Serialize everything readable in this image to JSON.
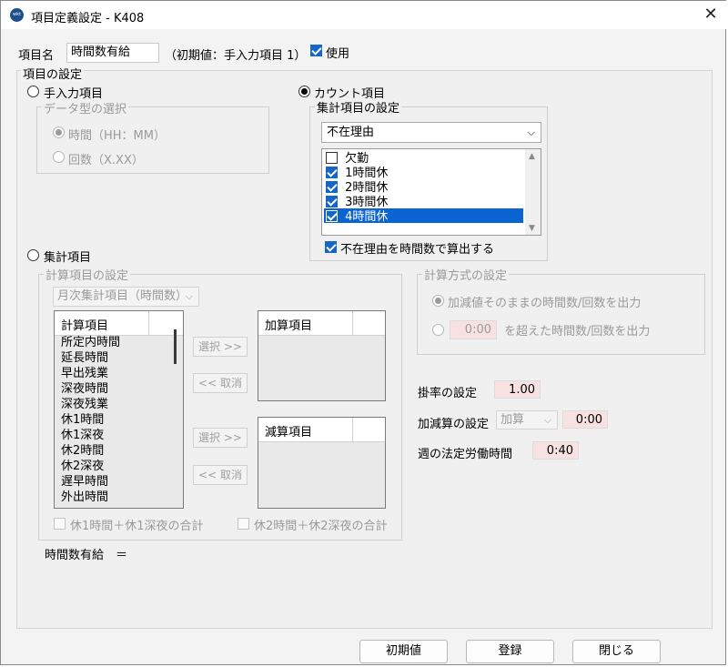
{
  "window": {
    "title": "項目定義設定 - K408",
    "app_icon_text": "wkt"
  },
  "item_name": {
    "label": "項目名",
    "value": "時間数有給",
    "initial": "（初期値：手入力項目 1）",
    "use_label": "使用",
    "use_checked": true
  },
  "settings": {
    "legend": "項目の設定",
    "manual": {
      "label": "手入力項目",
      "selected": false,
      "data_type_legend": "データ型の選択",
      "options": [
        {
          "label": "時間（HH：MM）",
          "selected": true
        },
        {
          "label": "回数（X.XX）",
          "selected": false
        }
      ]
    },
    "count": {
      "label": "カウント項目",
      "selected": true,
      "agg_legend": "集計項目の設定",
      "combo_value": "不在理由",
      "list": [
        {
          "label": "欠勤",
          "checked": false,
          "selected": false
        },
        {
          "label": "1時間休",
          "checked": true,
          "selected": false
        },
        {
          "label": "2時間休",
          "checked": true,
          "selected": false
        },
        {
          "label": "3時間休",
          "checked": true,
          "selected": false
        },
        {
          "label": "4時間休",
          "checked": true,
          "selected": true
        }
      ],
      "absence_hours_label": "不在理由を時間数で算出する",
      "absence_hours_checked": true
    },
    "aggregate": {
      "label": "集計項目",
      "selected": false,
      "calc_legend": "計算項目の設定",
      "monthly_combo": "月次集計項目（時間数）",
      "calc_items_header": "計算項目",
      "calc_items": [
        "所定内時間",
        "延長時間",
        "早出残業",
        "深夜時間",
        "深夜残業",
        "休1時間",
        "休1深夜",
        "休2時間",
        "休2深夜",
        "遅早時間",
        "外出時間"
      ],
      "add_header": "加算項目",
      "sub_header": "減算項目",
      "select_btn": "選択 >>",
      "cancel_btn": "<< 取消",
      "sum1_label": "休1時間＋休1深夜の合計",
      "sum2_label": "休2時間＋休2深夜の合計",
      "method_legend": "計算方式の設定",
      "method_opt1": "加減値そのままの時間数/回数を出力",
      "method_opt2_value": "0:00",
      "method_opt2_suffix": "を超えた時間数/回数を出力"
    },
    "rate_label": "掛率の設定",
    "rate_value": "1.00",
    "addsub_label": "加減算の設定",
    "addsub_combo": "加算",
    "addsub_value": "0:00",
    "weekly_label": "週の法定労働時間",
    "weekly_value": "0:40",
    "formula": "時間数有給　＝"
  },
  "buttons": {
    "initial": "初期値",
    "register": "登録",
    "close": "閉じる"
  }
}
